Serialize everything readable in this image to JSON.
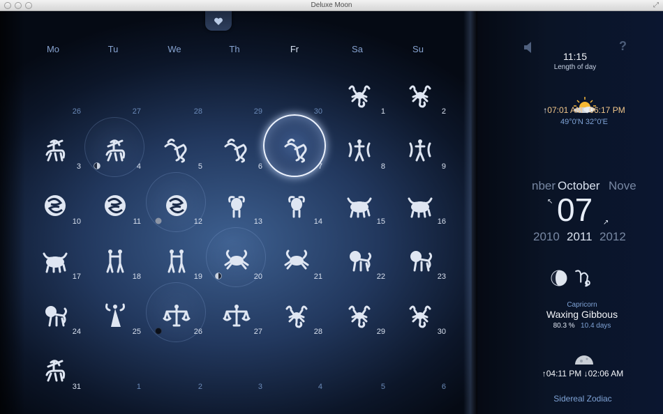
{
  "window": {
    "title": "Deluxe Moon"
  },
  "calendar": {
    "weekdays": [
      "Mo",
      "Tu",
      "We",
      "Th",
      "Fr",
      "Sa",
      "Su"
    ],
    "current_weekday_index": 4,
    "rows": [
      [
        {
          "day": "26",
          "other": true,
          "sign": ""
        },
        {
          "day": "27",
          "other": true,
          "sign": ""
        },
        {
          "day": "28",
          "other": true,
          "sign": ""
        },
        {
          "day": "29",
          "other": true,
          "sign": ""
        },
        {
          "day": "30",
          "other": true,
          "sign": ""
        },
        {
          "day": "1",
          "sign": "scorpio"
        },
        {
          "day": "2",
          "sign": "scorpio"
        }
      ],
      [
        {
          "day": "3",
          "sign": "sagittarius"
        },
        {
          "day": "4",
          "sign": "sagittarius",
          "ring": true,
          "phase": "first-quarter"
        },
        {
          "day": "5",
          "sign": "capricorn"
        },
        {
          "day": "6",
          "sign": "capricorn"
        },
        {
          "day": "7",
          "sign": "capricorn",
          "today": true
        },
        {
          "day": "8",
          "sign": "aquarius"
        },
        {
          "day": "9",
          "sign": "aquarius"
        }
      ],
      [
        {
          "day": "10",
          "sign": "pisces"
        },
        {
          "day": "11",
          "sign": "pisces"
        },
        {
          "day": "12",
          "sign": "pisces",
          "ring": true,
          "phase": "full"
        },
        {
          "day": "13",
          "sign": "aries"
        },
        {
          "day": "14",
          "sign": "aries"
        },
        {
          "day": "15",
          "sign": "taurus"
        },
        {
          "day": "16",
          "sign": "taurus"
        }
      ],
      [
        {
          "day": "17",
          "sign": "taurus"
        },
        {
          "day": "18",
          "sign": "gemini"
        },
        {
          "day": "19",
          "sign": "gemini"
        },
        {
          "day": "20",
          "sign": "cancer",
          "ring": true,
          "phase": "last-quarter"
        },
        {
          "day": "21",
          "sign": "cancer"
        },
        {
          "day": "22",
          "sign": "leo"
        },
        {
          "day": "23",
          "sign": "leo"
        }
      ],
      [
        {
          "day": "24",
          "sign": "leo"
        },
        {
          "day": "25",
          "sign": "virgo"
        },
        {
          "day": "26",
          "sign": "libra",
          "ring": true,
          "phase": "new"
        },
        {
          "day": "27",
          "sign": "libra"
        },
        {
          "day": "28",
          "sign": "scorpio"
        },
        {
          "day": "29",
          "sign": "scorpio"
        },
        {
          "day": "30",
          "sign": "scorpio"
        }
      ],
      [
        {
          "day": "31",
          "sign": "sagittarius"
        },
        {
          "day": "1",
          "other": true,
          "sign": ""
        },
        {
          "day": "2",
          "other": true,
          "sign": ""
        },
        {
          "day": "3",
          "other": true,
          "sign": ""
        },
        {
          "day": "4",
          "other": true,
          "sign": ""
        },
        {
          "day": "5",
          "other": true,
          "sign": ""
        },
        {
          "day": "6",
          "other": true,
          "sign": ""
        }
      ]
    ]
  },
  "day_info": {
    "day_length": "11:15",
    "day_length_label": "Length of day",
    "sunrise": "07:01 AM",
    "sunset": "06:17 PM",
    "location": "49°0'N 32°0'E"
  },
  "date_picker": {
    "month_prev": "nber",
    "month": "October",
    "month_next": "Nove",
    "day": "07",
    "year_prev": "2010",
    "year": "2011",
    "year_next": "2012"
  },
  "moon_info": {
    "zodiac_sign": "Capricorn",
    "phase_name": "Waxing Gibbous",
    "illumination": "80.3 %",
    "age": "10.4 days",
    "moonrise": "04:11 PM",
    "moonset": "02:06 AM",
    "zodiac_mode": "Sidereal Zodiac"
  },
  "icons": {
    "sound": "speaker-icon",
    "help": "?",
    "favorite": "heart-icon"
  },
  "colors": {
    "accent_orange": "#f1c68a",
    "accent_blue": "#7fa3d6",
    "today_ring": "#eef4ff"
  }
}
